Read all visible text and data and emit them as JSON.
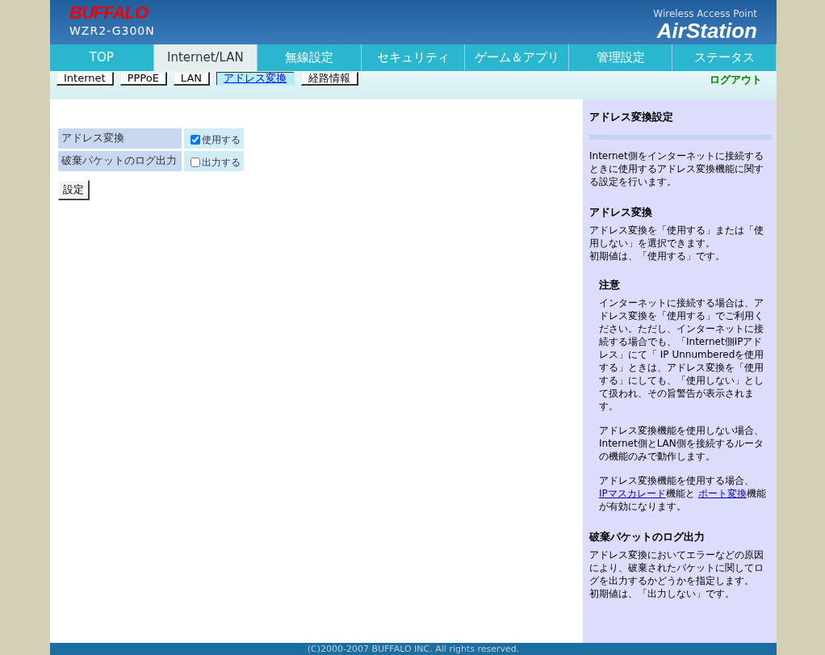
{
  "header": {
    "brand": "BUFFALO",
    "model": "WZR2-G300N",
    "tagline": "Wireless Access Point",
    "product": "AirStation"
  },
  "tabs": [
    {
      "label": "TOP",
      "selected": false
    },
    {
      "label": "Internet/LAN",
      "selected": true
    },
    {
      "label": "無線設定",
      "selected": false
    },
    {
      "label": "セキュリティ",
      "selected": false
    },
    {
      "label": "ゲーム＆アプリ",
      "selected": false
    },
    {
      "label": "管理設定",
      "selected": false
    },
    {
      "label": "ステータス",
      "selected": false
    }
  ],
  "subtabs": [
    {
      "label": "Internet",
      "selected": false
    },
    {
      "label": "PPPoE",
      "selected": false
    },
    {
      "label": "LAN",
      "selected": false
    },
    {
      "label": "アドレス変換",
      "selected": true
    },
    {
      "label": "経路情報",
      "selected": false
    }
  ],
  "logout": "ログアウト",
  "settings": [
    {
      "label": "アドレス変換",
      "option": "使用する",
      "checked": true
    },
    {
      "label": "破棄パケットのログ出力",
      "option": "出力する",
      "checked": false
    }
  ],
  "submit": "設定",
  "help": {
    "title": "アドレス変換設定",
    "sections": [
      {
        "kind": "text",
        "paragraphs": [
          [
            {
              "text": "Internet側をインターネットに接続するときに使用するアドレス変換機能に関する設定を行います。"
            }
          ]
        ]
      },
      {
        "kind": "text",
        "heading": "アドレス変換",
        "paragraphs": [
          [
            {
              "text": "アドレス変換を「使用する」または「使用しない」を選択できます。"
            }
          ],
          [
            {
              "text": "初期値は、「使用する」です。"
            }
          ]
        ]
      },
      {
        "kind": "note",
        "heading": "注意",
        "paragraphs": [
          [
            {
              "text": "インターネットに接続する場合は、アドレス変換を「使用する」でご利用ください。ただし、インターネットに接続する場合でも、「Internet側IPアドレス」にて「 IP Unnumberedを使用する」ときは、アドレス変換を「使用する」にしても、「使用しない」として扱われ、その旨警告が表示されます。"
            }
          ],
          [
            {
              "text": "アドレス変換機能を使用しない場合、Internet側とLAN側を接続するルータの機能のみで動作します。"
            }
          ],
          [
            {
              "text": "アドレス変換機能を使用する場合、"
            },
            {
              "text": "IPマスカレード",
              "link": true
            },
            {
              "text": "機能と "
            },
            {
              "text": "ポート変換",
              "link": true
            },
            {
              "text": "機能が有効になります。"
            }
          ]
        ]
      },
      {
        "kind": "text",
        "heading": "破棄パケットのログ出力",
        "paragraphs": [
          [
            {
              "text": "アドレス変換においてエラーなどの原因により、破棄されたパケットに関してログを出力するかどうかを指定します。"
            }
          ],
          [
            {
              "text": "初期値は、「出力しない」です。"
            }
          ]
        ]
      }
    ]
  },
  "footer": "(C)2000-2007 BUFFALO INC. All rights reserved."
}
